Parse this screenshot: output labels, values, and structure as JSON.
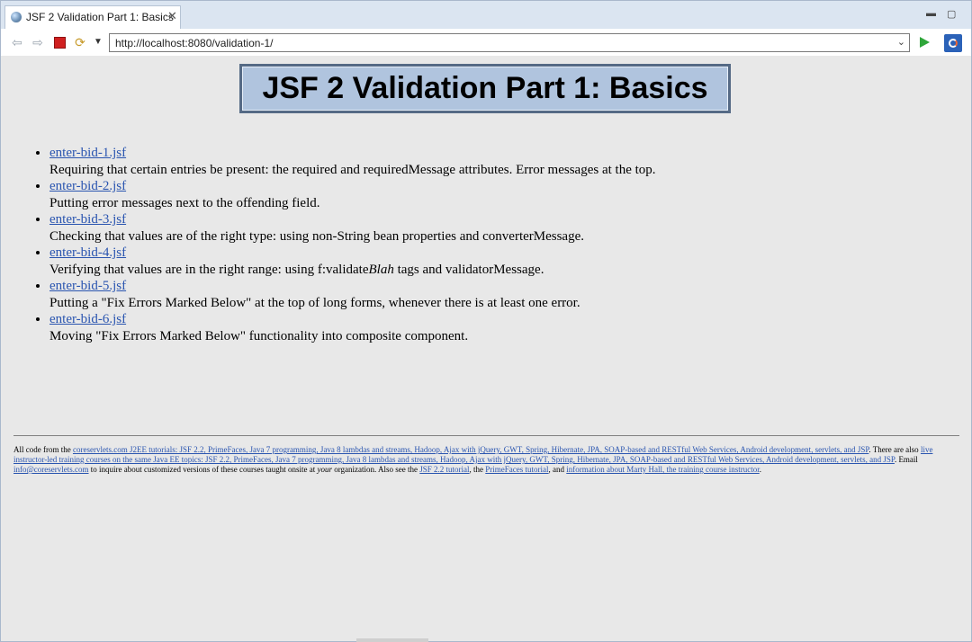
{
  "tab": {
    "title": "JSF 2 Validation Part 1: Basics"
  },
  "toolbar": {
    "url": "http://localhost:8080/validation-1/"
  },
  "page": {
    "title": "JSF 2 Validation Part 1: Basics",
    "items": [
      {
        "link": "enter-bid-1.jsf",
        "desc": "Requiring that certain entries be present: the required and requiredMessage attributes. Error messages at the top."
      },
      {
        "link": "enter-bid-2.jsf",
        "desc": "Putting error messages next to the offending field."
      },
      {
        "link": "enter-bid-3.jsf",
        "desc": "Checking that values are of the right type: using non-String bean properties and converterMessage."
      },
      {
        "link": "enter-bid-4.jsf",
        "desc_before": "Verifying that values are in the right range: using f:validate",
        "desc_em": "Blah",
        "desc_after": " tags and validatorMessage."
      },
      {
        "link": "enter-bid-5.jsf",
        "desc": "Putting a \"Fix Errors Marked Below\" at the top of long forms, whenever there is at least one error."
      },
      {
        "link": "enter-bid-6.jsf",
        "desc": "Moving \"Fix Errors Marked Below\" functionality into composite component."
      }
    ]
  },
  "footer": {
    "t1": "All code from the ",
    "l1": "coreservlets.com J2EE tutorials: JSF 2.2, PrimeFaces, Java 7 programming, Java 8 lambdas and streams, Hadoop, Ajax with jQuery, GWT, Spring, Hibernate, JPA, SOAP-based and RESTful Web Services, Android development, servlets, and JSP",
    "t2": ". There are also ",
    "l2": "live instructor-led training courses on the same Java EE topics: JSF 2.2, PrimeFaces, Java 7 programming, Java 8 lambdas and streams, Hadoop, Ajax with jQuery, GWT, Spring, Hibernate, JPA, SOAP-based and RESTful Web Services, Android development, servlets, and JSP",
    "t3": ". Email ",
    "l3": "info@coreservlets.com",
    "t4": " to inquire about customized versions of these courses taught onsite at ",
    "em": "your",
    "t5": " organization. Also see the ",
    "l4": "JSF 2.2 tutorial",
    "t6": ", the ",
    "l5": "PrimeFaces tutorial",
    "t7": ", and ",
    "l6": "information about Marty Hall, the training course instructor",
    "t8": "."
  }
}
